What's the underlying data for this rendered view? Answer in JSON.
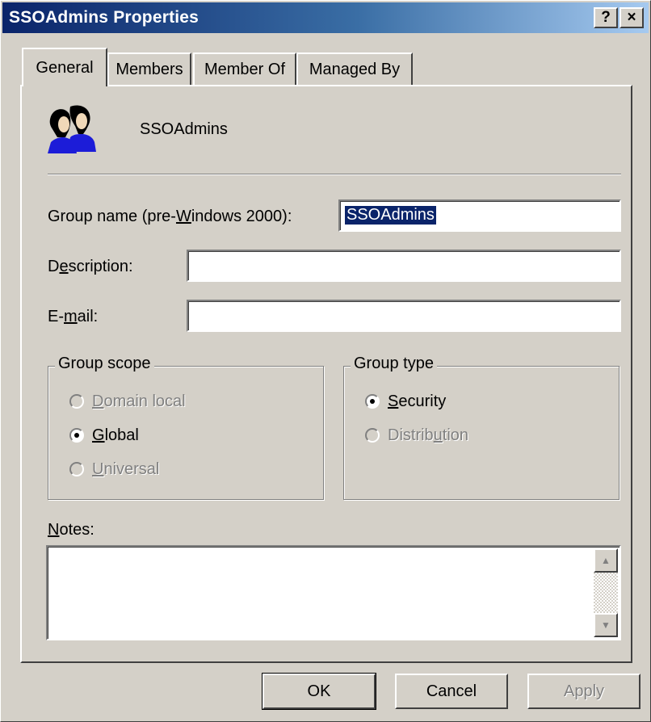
{
  "window": {
    "title": "SSOAdmins Properties",
    "help_glyph": "?",
    "close_glyph": "×"
  },
  "tabs": [
    {
      "label": "General",
      "active": true
    },
    {
      "label": "Members",
      "active": false
    },
    {
      "label": "Member Of",
      "active": false
    },
    {
      "label": "Managed By",
      "active": false
    }
  ],
  "general": {
    "group_display_name": "SSOAdmins",
    "group_name_label_pre": "Group name (pre-",
    "group_name_label_u": "W",
    "group_name_label_post": "indows 2000):",
    "group_name_value": "SSOAdmins",
    "description_label_pre": "D",
    "description_label_u": "e",
    "description_label_post": "scription:",
    "description_value": "",
    "email_label_pre": "E-",
    "email_label_u": "m",
    "email_label_post": "ail:",
    "email_value": "",
    "notes_label_u": "N",
    "notes_label_post": "otes:",
    "notes_value": ""
  },
  "group_scope": {
    "legend": "Group scope",
    "options": [
      {
        "u": "D",
        "rest": "omain local",
        "checked": false,
        "enabled": false
      },
      {
        "u": "G",
        "rest": "lobal",
        "checked": true,
        "enabled": true
      },
      {
        "u": "U",
        "rest": "niversal",
        "checked": false,
        "enabled": false
      }
    ]
  },
  "group_type": {
    "legend": "Group type",
    "options": [
      {
        "u": "S",
        "pre": "",
        "rest": "ecurity",
        "checked": true,
        "enabled": true
      },
      {
        "u": "u",
        "pre": "Distrib",
        "rest": "tion",
        "checked": false,
        "enabled": false
      }
    ]
  },
  "buttons": {
    "ok": "OK",
    "cancel": "Cancel",
    "apply": "Apply"
  },
  "colors": {
    "titlebar_start": "#0a246a",
    "titlebar_end": "#a6caf0",
    "face": "#d4d0c8",
    "selection": "#0a246a"
  }
}
